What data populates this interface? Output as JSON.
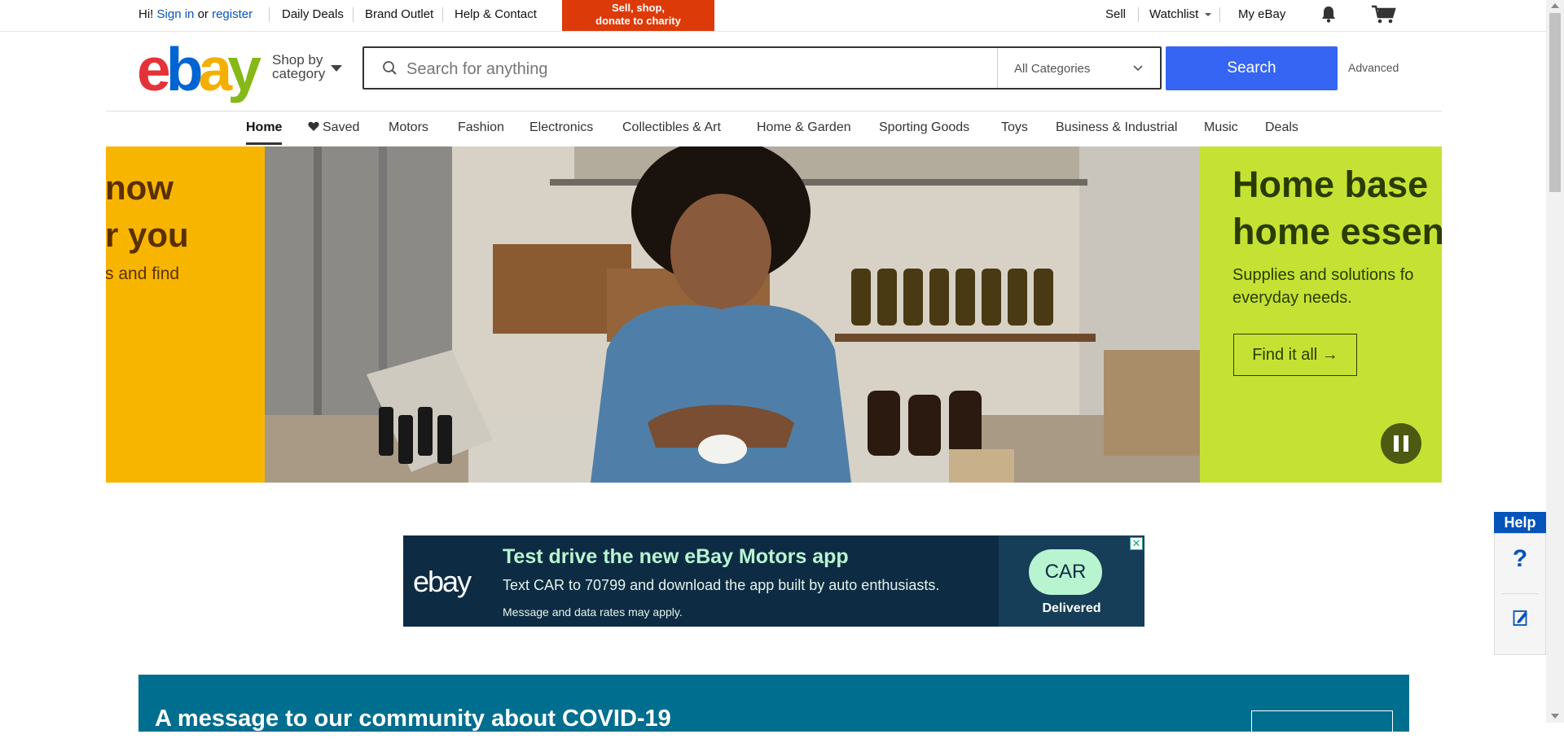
{
  "topbar": {
    "greeting": "Hi!",
    "signin": "Sign in",
    "or": "or",
    "register": "register",
    "daily_deals": "Daily Deals",
    "brand_outlet": "Brand Outlet",
    "help_contact": "Help & Contact",
    "charity_line1": "Sell, shop,",
    "charity_line2": "donate to charity",
    "sell": "Sell",
    "watchlist": "Watchlist",
    "my_ebay": "My eBay",
    "icons": [
      "chevron-down-icon",
      "bell-icon",
      "cart-icon"
    ]
  },
  "header": {
    "logo_letters": [
      "e",
      "b",
      "a",
      "y"
    ],
    "logo_colors": [
      "#e53238",
      "#0064d2",
      "#f5af02",
      "#86b817"
    ],
    "shop_by_line1": "Shop by",
    "shop_by_line2": "category",
    "search_placeholder": "Search for anything",
    "category_select": "All Categories",
    "search_button": "Search",
    "advanced": "Advanced"
  },
  "nav": {
    "items": [
      "Home",
      "Saved",
      "Motors",
      "Fashion",
      "Electronics",
      "Collectibles & Art",
      "Home & Garden",
      "Sporting Goods",
      "Toys",
      "Business & Industrial",
      "Music",
      "Deals"
    ],
    "active": "Home"
  },
  "hero": {
    "left_line1": "now",
    "left_line2": "r you",
    "left_sub": "s and find",
    "title_line1": "Home base",
    "title_line2": "home essen",
    "sub_line1": "Supplies and solutions fo",
    "sub_line2": "everyday needs.",
    "cta": "Find it all →",
    "colors": {
      "left_panel": "#f7b500",
      "right_panel": "#c5e234",
      "title_text": "#2a3c00"
    }
  },
  "ad": {
    "logo": "ebay",
    "title": "Test drive the new eBay Motors app",
    "body": "Text CAR to 70799 and download the app built by auto enthusiasts.",
    "fine_print": "Message and data rates may apply.",
    "bubble": "CAR",
    "delivered": "Delivered",
    "close": "✕"
  },
  "covid": {
    "title": "A message to our community about COVID-19"
  },
  "help": {
    "tab": "Help",
    "question": "?"
  }
}
